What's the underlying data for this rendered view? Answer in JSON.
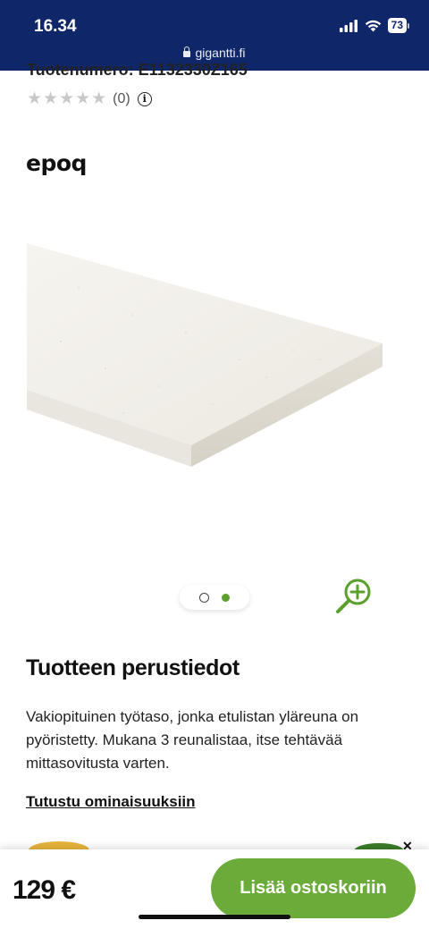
{
  "status_bar": {
    "time": "16.34",
    "battery": "73",
    "url": "gigantti.fi",
    "icons": [
      "signal-icon",
      "wifi-icon",
      "battery-icon",
      "lock-icon"
    ]
  },
  "product": {
    "product_number_partial": "Tuotenumero: E1132330Z165",
    "rating": {
      "stars_filled": 0,
      "stars_total": 5,
      "count": "(0)"
    },
    "brand": "epoq"
  },
  "gallery": {
    "total_slides": 2,
    "active_slide": 2
  },
  "details": {
    "title": "Tuotteen perustiedot",
    "description": "Vakiopituinen työtaso, jonka etulistan yläreuna on pyöristetty. Mukana 3 reunalistaa, itse tehtävää mittasovitusta varten.",
    "link_label": "Tutustu ominaisuuksiin"
  },
  "purchase": {
    "price": "129 €",
    "add_to_cart_label": "Lisää ostoskoriin"
  },
  "colors": {
    "header_bg": "#0f2669",
    "accent_green": "#6bab3a"
  }
}
